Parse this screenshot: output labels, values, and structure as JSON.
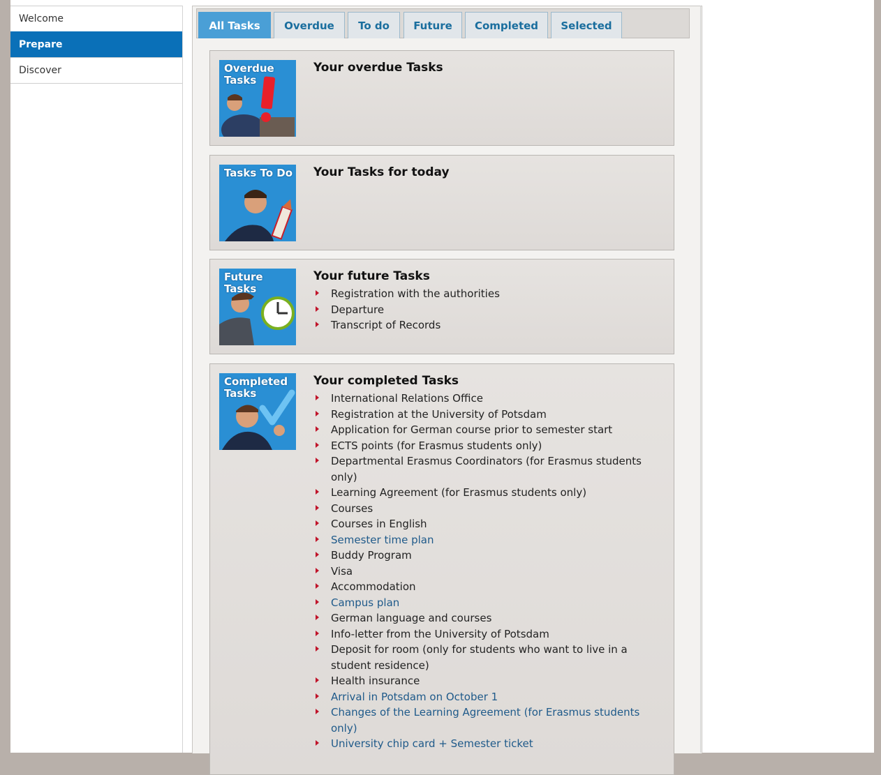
{
  "sidebar": {
    "items": [
      {
        "label": "Welcome",
        "active": false
      },
      {
        "label": "Prepare",
        "active": true
      },
      {
        "label": "Discover",
        "active": false
      }
    ]
  },
  "tabs": [
    {
      "label": "All Tasks",
      "active": true
    },
    {
      "label": "Overdue",
      "active": false
    },
    {
      "label": "To do",
      "active": false
    },
    {
      "label": "Future",
      "active": false
    },
    {
      "label": "Completed",
      "active": false
    },
    {
      "label": "Selected",
      "active": false
    }
  ],
  "panels": {
    "overdue": {
      "image_label": "Overdue\nTasks",
      "title": "Your overdue Tasks",
      "items": []
    },
    "todo": {
      "image_label": "Tasks To Do",
      "title": "Your Tasks for today",
      "items": []
    },
    "future": {
      "image_label": "Future Tasks",
      "title": "Your future Tasks",
      "items": [
        "Registration with the authorities",
        "Departure",
        "Transcript of Records"
      ]
    },
    "completed": {
      "image_label": "Completed\nTasks",
      "title": "Your completed Tasks",
      "items": [
        "International Relations Office",
        "Registration at the University of Potsdam",
        "Application for German course prior to semester start",
        "ECTS points (for Erasmus students only)",
        "Departmental Erasmus Coordinators (for Erasmus students only)",
        "Learning Agreement (for Erasmus students only)",
        "Courses",
        "Courses in English",
        "Semester time plan",
        "Buddy Program",
        "Visa",
        "Accommodation",
        "Campus plan",
        "German language and courses",
        "Info-letter from the University of Potsdam",
        "Deposit for room (only for students who want to live in a student residence)",
        "Health insurance",
        "Arrival in Potsdam on October 1",
        "Changes of the Learning Agreement (for Erasmus students only)",
        "University chip card + Semester ticket"
      ],
      "link_items": [
        "Semester time plan",
        "Campus plan",
        "Arrival in Potsdam on October 1",
        "Changes of the Learning Agreement (for Erasmus students only)",
        "University chip card + Semester ticket"
      ]
    }
  },
  "colors": {
    "accent": "#0a70b8",
    "active_tab": "#4a9fd6",
    "tab_text": "#1a6e9e",
    "bullet": "#c0142a",
    "link": "#1f5a8a",
    "image_bg": "#2a8fd4"
  },
  "icons": {
    "bullet": "red-triangle-bullet",
    "overdue": "exclamation-icon",
    "todo": "pencil-icon",
    "future": "clock-icon",
    "completed": "checkmark-icon"
  }
}
